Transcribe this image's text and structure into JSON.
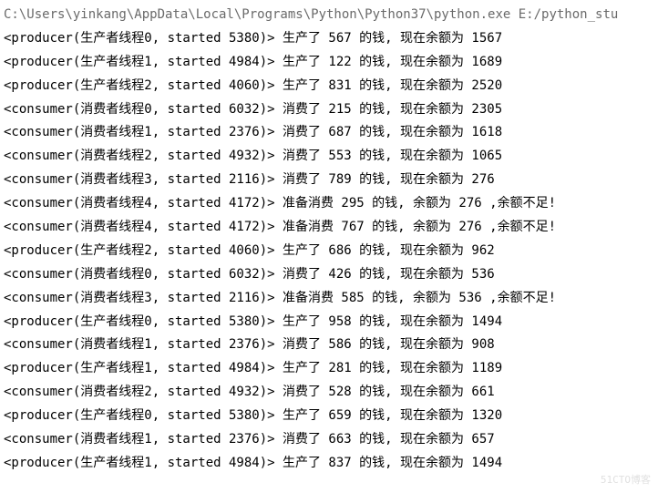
{
  "command": "C:\\Users\\yinkang\\AppData\\Local\\Programs\\Python\\Python37\\python.exe E:/python_stu",
  "lines": [
    "<producer(生产者线程0, started 5380)> 生产了 567 的钱, 现在余额为 1567",
    "<producer(生产者线程1, started 4984)> 生产了 122 的钱, 现在余额为 1689",
    "<producer(生产者线程2, started 4060)> 生产了 831 的钱, 现在余额为 2520",
    "<consumer(消费者线程0, started 6032)> 消费了 215 的钱, 现在余额为 2305",
    "<consumer(消费者线程1, started 2376)> 消费了 687 的钱, 现在余额为 1618",
    "<consumer(消费者线程2, started 4932)> 消费了 553 的钱, 现在余额为 1065",
    "<consumer(消费者线程3, started 2116)> 消费了 789 的钱, 现在余额为 276",
    "<consumer(消费者线程4, started 4172)> 准备消费 295 的钱, 余额为 276 ,余额不足!",
    "<consumer(消费者线程4, started 4172)> 准备消费 767 的钱, 余额为 276 ,余额不足!",
    "<producer(生产者线程2, started 4060)> 生产了 686 的钱, 现在余额为 962",
    "<consumer(消费者线程0, started 6032)> 消费了 426 的钱, 现在余额为 536",
    "<consumer(消费者线程3, started 2116)> 准备消费 585 的钱, 余额为 536 ,余额不足!",
    "<producer(生产者线程0, started 5380)> 生产了 958 的钱, 现在余额为 1494",
    "<consumer(消费者线程1, started 2376)> 消费了 586 的钱, 现在余额为 908",
    "<producer(生产者线程1, started 4984)> 生产了 281 的钱, 现在余额为 1189",
    "<consumer(消费者线程2, started 4932)> 消费了 528 的钱, 现在余额为 661",
    "<producer(生产者线程0, started 5380)> 生产了 659 的钱, 现在余额为 1320",
    "<consumer(消费者线程1, started 2376)> 消费了 663 的钱, 现在余额为 657",
    "<producer(生产者线程1, started 4984)> 生产了 837 的钱, 现在余额为 1494"
  ],
  "watermark": "51CTO博客"
}
